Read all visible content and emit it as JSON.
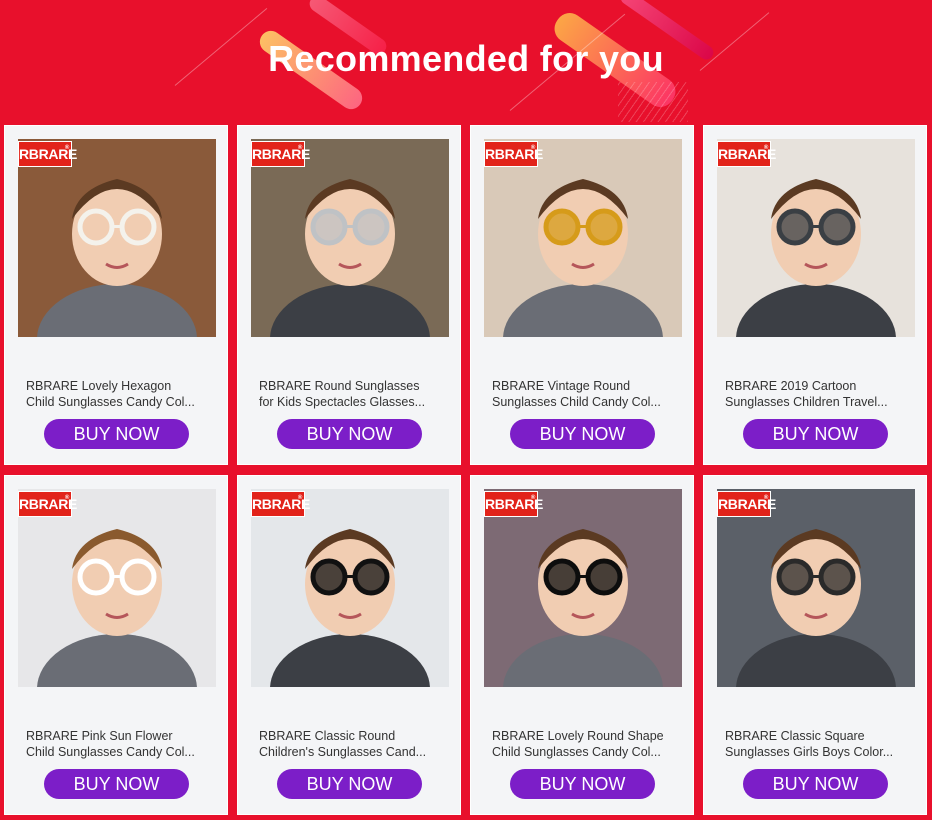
{
  "header": {
    "title": "Recommended for you"
  },
  "brand_logo": "RBRARE",
  "products": [
    {
      "line1": "RBRARE Lovely Hexagon",
      "line2": "Child Sunglasses Candy Col...",
      "button": "BUY NOW",
      "bg": "#8a5a3a",
      "glasses": "#f4f2ec"
    },
    {
      "line1": "RBRARE Round Sunglasses",
      "line2": "for Kids Spectacles Glasses...",
      "button": "BUY NOW",
      "bg": "#7a6a56",
      "glasses": "#bfc2c5"
    },
    {
      "line1": "RBRARE Vintage Round",
      "line2": "Sunglasses Child Candy Col...",
      "button": "BUY NOW",
      "bg": "#d9c9b8",
      "glasses": "#d69b1a"
    },
    {
      "line1": "RBRARE 2019 Cartoon",
      "line2": "Sunglasses Children Travel...",
      "button": "BUY NOW",
      "bg": "#e7e2dc",
      "glasses": "#3a3f44"
    },
    {
      "line1": "RBRARE Pink Sun Flower",
      "line2": "Child Sunglasses Candy Col...",
      "button": "BUY NOW",
      "bg": "#e7e7e9",
      "glasses": "#ffffff"
    },
    {
      "line1": "RBRARE Classic Round",
      "line2": "Children's Sunglasses Cand...",
      "button": "BUY NOW",
      "bg": "#e4e7ea",
      "glasses": "#111111"
    },
    {
      "line1": "RBRARE Lovely Round Shape",
      "line2": "Child Sunglasses Candy Col...",
      "button": "BUY NOW",
      "bg": "#7d6a74",
      "glasses": "#0d0d0d"
    },
    {
      "line1": "RBRARE Classic Square",
      "line2": "Sunglasses Girls Boys Color...",
      "button": "BUY NOW",
      "bg": "#5b6068",
      "glasses": "#2a2a2a"
    }
  ],
  "colors": {
    "background": "#e8102c",
    "button": "#7c1ec8",
    "card": "#f4f5f7",
    "logo": "#e2231a"
  }
}
